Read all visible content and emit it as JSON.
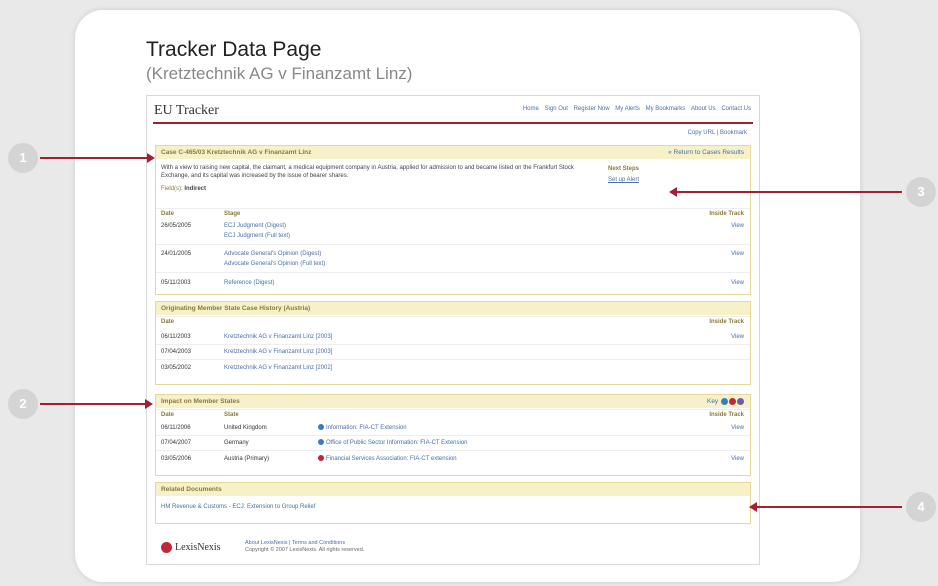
{
  "page": {
    "title": "Tracker Data Page",
    "subtitle": "(Kretztechnik AG v Finanzamt Linz)"
  },
  "header": {
    "brand": "EU Tracker",
    "nav": [
      "Home",
      "Sign Out",
      "Register Now",
      "My Alerts",
      "My Bookmarks",
      "About Us",
      "Contact Us"
    ],
    "copy_url": "Copy URL",
    "bookmark": "Bookmark"
  },
  "case": {
    "bar_title": "Case C-465/03 Kretztechnik AG v Finanzamt Linz",
    "return_link": "« Return to Cases Results",
    "description": "With a view to raising new capital, the claimant, a medical equipment company in Austria, applied for admission to and became listed on the Frankfurt Stock Exchange, and its capital was increased by the issue of bearer shares.",
    "fields_label": "Field(s):",
    "fields_value": "Indirect",
    "track_heading": "Next Steps",
    "track_link": "Set up Alert",
    "columns": [
      "Date",
      "Stage",
      "Inside Track"
    ],
    "rows": [
      {
        "date": "26/05/2005",
        "stages": [
          "ECJ Judgment (Digest)",
          "ECJ Judgment (Full text)"
        ],
        "track": "View"
      },
      {
        "date": "24/01/2005",
        "stages": [
          "Advocate General's Opinion (Digest)",
          "Advocate General's Opinion (Full text)"
        ],
        "track": "View"
      },
      {
        "date": "05/11/2003",
        "stages": [
          "Reference (Digest)"
        ],
        "track": "View"
      }
    ]
  },
  "originating": {
    "bar_title": "Originating Member State Case History (Austria)",
    "columns": [
      "Date",
      "Inside Track"
    ],
    "rows": [
      {
        "date": "06/11/2003",
        "case": "Kretztechnik AG v Finanzamt Linz [2003]",
        "track": "View"
      },
      {
        "date": "07/04/2003",
        "case": "Kretztechnik AG v Finanzamt Linz [2003]",
        "track": ""
      },
      {
        "date": "03/05/2002",
        "case": "Kretztechnik AG v Finanzamt Linz [2002]",
        "track": ""
      }
    ]
  },
  "impact": {
    "bar_title": "Impact on Member States",
    "key_label": "Key",
    "columns": [
      "Date",
      "State",
      "Inside Track"
    ],
    "rows": [
      {
        "date": "06/11/2006",
        "state": "United Kingdom",
        "link": "Information: FIA-CT Extension",
        "track": "View"
      },
      {
        "date": "07/04/2007",
        "state": "Germany",
        "link": "Office of Public Sector Information: FIA-CT Extension",
        "track": ""
      },
      {
        "date": "03/05/2006",
        "state": "Austria (Primary)",
        "link": "Financial Services Association: FIA-CT extension",
        "track": "View"
      }
    ]
  },
  "related": {
    "bar_title": "Related Documents",
    "item": "HM Revenue & Customs - ECJ: Extension to Group Relief"
  },
  "footer": {
    "logo": "LexisNexis",
    "links": "About LexisNexis | Terms and Conditions",
    "copyright": "Copyright © 2007 LexisNexis. All rights reserved."
  },
  "callouts": [
    "1",
    "2",
    "3",
    "4"
  ],
  "colors": {
    "accent": "#a31f34",
    "bar_bg": "#f6f1c9",
    "link": "#4a6fa5"
  }
}
